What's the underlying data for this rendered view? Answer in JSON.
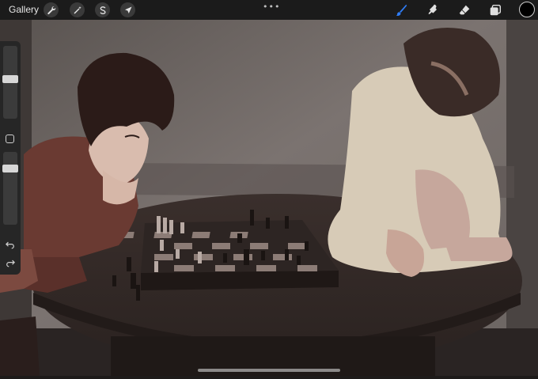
{
  "app": {
    "gallery_label": "Gallery",
    "more_menu_icon": "ellipsis-icon"
  },
  "left_tools": [
    {
      "name": "actions-wrench-icon"
    },
    {
      "name": "adjustments-wand-icon"
    },
    {
      "name": "selection-s-icon"
    },
    {
      "name": "transform-arrow-icon"
    }
  ],
  "right_tools": [
    {
      "name": "brush-icon",
      "active": true
    },
    {
      "name": "smudge-icon"
    },
    {
      "name": "eraser-icon"
    },
    {
      "name": "layers-icon"
    }
  ],
  "current_color": "#000000",
  "accent_color": "#2f7df6",
  "sidebar": {
    "brush_size_level": 0.55,
    "opacity_level": 0.8
  }
}
